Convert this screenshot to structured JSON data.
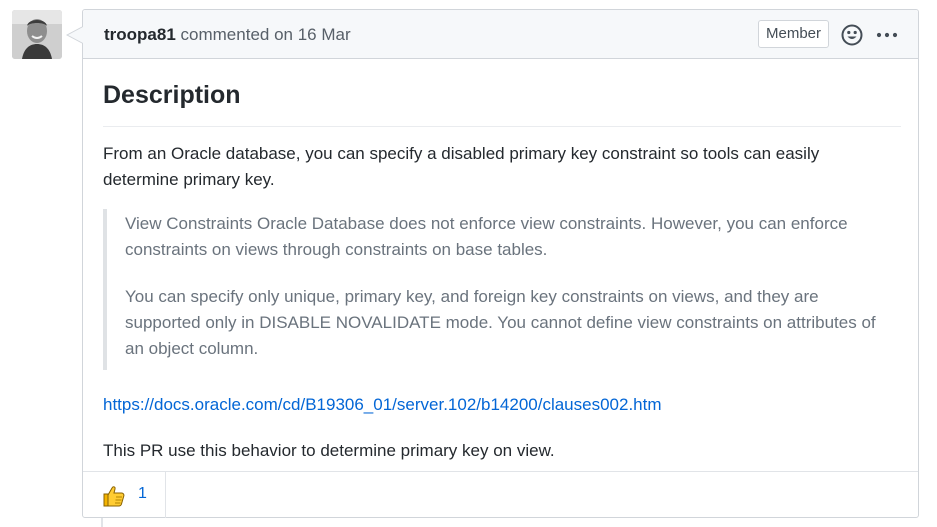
{
  "comment": {
    "author": "troopa81",
    "action": "commented on 16 Mar",
    "badge": "Member",
    "heading": "Description",
    "intro": "From an Oracle database, you can specify a disabled primary key constraint so tools can easily determine primary key.",
    "quote": [
      "View Constraints Oracle Database does not enforce view constraints. However, you can enforce constraints on views through constraints on base tables.",
      "You can specify only unique, primary key, and foreign key constraints on views, and they are supported only in DISABLE NOVALIDATE mode. You cannot define view constraints on attributes of an object column."
    ],
    "link": "https://docs.oracle.com/cd/B19306_01/server.102/b14200/clauses002.htm",
    "closing": "This PR use this behavior to determine primary key on view."
  },
  "reactions": [
    {
      "icon": "thumbs-up-icon",
      "count": "1"
    }
  ],
  "icons": {
    "emoji": "smiley-icon",
    "more": "kebab-horizontal-icon"
  },
  "colors": {
    "link": "#0366d6",
    "border": "#d1d5da",
    "header_bg": "#f6f8fa",
    "quote_text": "#6a737d"
  }
}
